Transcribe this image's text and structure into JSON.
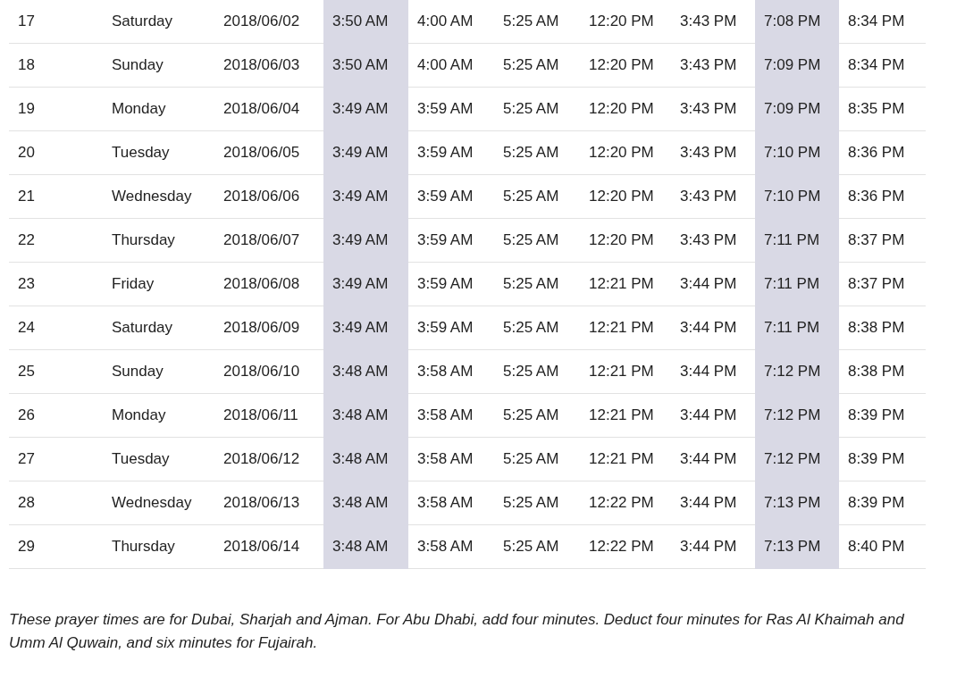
{
  "table": {
    "columns": [
      {
        "highlighted": false
      },
      {
        "highlighted": false
      },
      {
        "highlighted": false
      },
      {
        "highlighted": true
      },
      {
        "highlighted": false
      },
      {
        "highlighted": false
      },
      {
        "highlighted": false
      },
      {
        "highlighted": false
      },
      {
        "highlighted": true
      },
      {
        "highlighted": false
      }
    ],
    "rows": [
      [
        "17",
        "Saturday",
        "2018/06/02",
        "3:50 AM",
        "4:00 AM",
        "5:25 AM",
        "12:20 PM",
        "3:43 PM",
        "7:08 PM",
        "8:34 PM"
      ],
      [
        "18",
        "Sunday",
        "2018/06/03",
        "3:50 AM",
        "4:00 AM",
        "5:25 AM",
        "12:20 PM",
        "3:43 PM",
        "7:09 PM",
        "8:34 PM"
      ],
      [
        "19",
        "Monday",
        "2018/06/04",
        "3:49 AM",
        "3:59 AM",
        "5:25 AM",
        "12:20 PM",
        "3:43 PM",
        "7:09 PM",
        "8:35 PM"
      ],
      [
        "20",
        "Tuesday",
        "2018/06/05",
        "3:49 AM",
        "3:59 AM",
        "5:25 AM",
        "12:20 PM",
        "3:43 PM",
        "7:10 PM",
        "8:36 PM"
      ],
      [
        "21",
        "Wednesday",
        "2018/06/06",
        "3:49 AM",
        "3:59 AM",
        "5:25 AM",
        "12:20 PM",
        "3:43 PM",
        "7:10 PM",
        "8:36 PM"
      ],
      [
        "22",
        "Thursday",
        "2018/06/07",
        "3:49 AM",
        "3:59 AM",
        "5:25 AM",
        "12:20 PM",
        "3:43 PM",
        "7:11 PM",
        "8:37 PM"
      ],
      [
        "23",
        "Friday",
        "2018/06/08",
        "3:49 AM",
        "3:59 AM",
        "5:25 AM",
        "12:21 PM",
        "3:44 PM",
        "7:11 PM",
        "8:37 PM"
      ],
      [
        "24",
        "Saturday",
        "2018/06/09",
        "3:49 AM",
        "3:59 AM",
        "5:25 AM",
        "12:21 PM",
        "3:44 PM",
        "7:11 PM",
        "8:38 PM"
      ],
      [
        "25",
        "Sunday",
        "2018/06/10",
        "3:48 AM",
        "3:58 AM",
        "5:25 AM",
        "12:21 PM",
        "3:44 PM",
        "7:12 PM",
        "8:38 PM"
      ],
      [
        "26",
        "Monday",
        "2018/06/11",
        "3:48 AM",
        "3:58 AM",
        "5:25 AM",
        "12:21 PM",
        "3:44 PM",
        "7:12 PM",
        "8:39 PM"
      ],
      [
        "27",
        "Tuesday",
        "2018/06/12",
        "3:48 AM",
        "3:58 AM",
        "5:25 AM",
        "12:21 PM",
        "3:44 PM",
        "7:12 PM",
        "8:39 PM"
      ],
      [
        "28",
        "Wednesday",
        "2018/06/13",
        "3:48 AM",
        "3:58 AM",
        "5:25 AM",
        "12:22 PM",
        "3:44 PM",
        "7:13 PM",
        "8:39 PM"
      ],
      [
        "29",
        "Thursday",
        "2018/06/14",
        "3:48 AM",
        "3:58 AM",
        "5:25 AM",
        "12:22 PM",
        "3:44 PM",
        "7:13 PM",
        "8:40 PM"
      ]
    ]
  },
  "footnote": "These prayer times are for Dubai, Sharjah and Ajman. For Abu Dhabi, add four minutes. Deduct four minutes for Ras Al Khaimah and Umm Al Quwain, and six minutes for Fujairah."
}
